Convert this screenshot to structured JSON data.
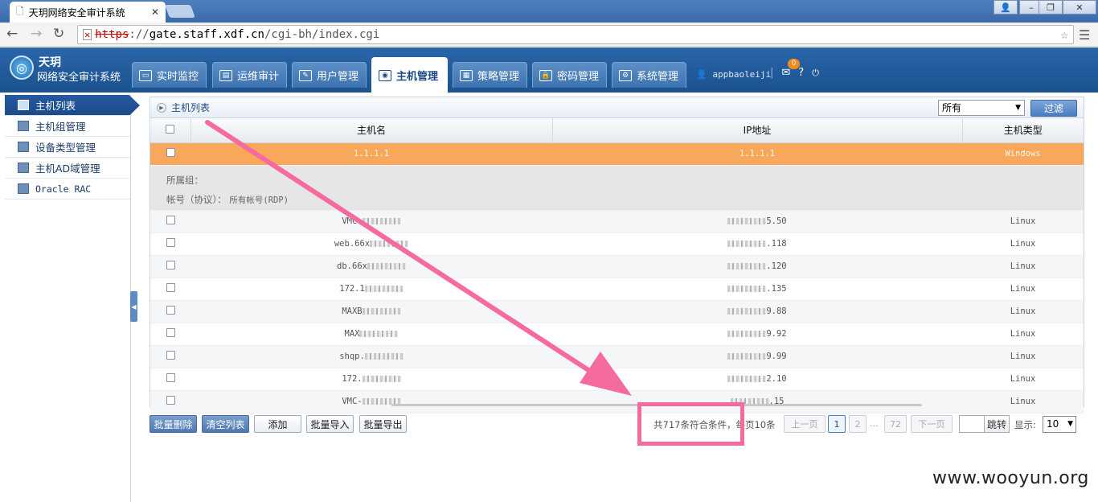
{
  "browser": {
    "tab_title": "天玥网络安全审计系统",
    "url_scheme": "https",
    "url_host": "gate.staff.xdf.cn",
    "url_path": "/cgi-bh/index.cgi",
    "url_rest": "://"
  },
  "app": {
    "brand_line1": "天玥",
    "brand_line2": "网络安全审计系统",
    "tabs": [
      {
        "label": "实时监控",
        "icon": "monitor-icon"
      },
      {
        "label": "运维审计",
        "icon": "audit-icon"
      },
      {
        "label": "用户管理",
        "icon": "user-icon"
      },
      {
        "label": "主机管理",
        "icon": "host-icon"
      },
      {
        "label": "策略管理",
        "icon": "policy-icon"
      },
      {
        "label": "密码管理",
        "icon": "lock-icon"
      },
      {
        "label": "系统管理",
        "icon": "gear-icon"
      }
    ],
    "active_tab": "主机管理",
    "username": "appbaoleiji",
    "mail_badge": "0",
    "help": "?",
    "logout": "⏻"
  },
  "sidebar": {
    "items": [
      {
        "label": "主机列表"
      },
      {
        "label": "主机组管理"
      },
      {
        "label": "设备类型管理"
      },
      {
        "label": "主机AD域管理"
      },
      {
        "label": "Oracle RAC"
      }
    ]
  },
  "panel": {
    "breadcrumb": "主机列表",
    "filter_select": "所有",
    "filter_button": "过滤",
    "columns": [
      "主机名",
      "IP地址",
      "主机类型"
    ],
    "selected_row": {
      "host": "1.1.1.1",
      "ip": "1.1.1.1",
      "type": "Windows"
    },
    "detail": {
      "group_label": "所属组：",
      "account_label": "帐号（协议）：",
      "account_value": "所有帐号(RDP)"
    },
    "rows": [
      {
        "host": "VMC-",
        "ip": "5.50",
        "type": "Linux"
      },
      {
        "host": "web.66x",
        "ip": ".118",
        "type": "Linux"
      },
      {
        "host": "db.66x",
        "ip": ".120",
        "type": "Linux"
      },
      {
        "host": "172.1",
        "ip": ".135",
        "type": "Linux"
      },
      {
        "host": "MAXB",
        "ip": "9.88",
        "type": "Linux"
      },
      {
        "host": "MAX",
        "ip": "9.92",
        "type": "Linux"
      },
      {
        "host": "shqp.",
        "ip": "9.99",
        "type": "Linux"
      },
      {
        "host": "172.",
        "ip": "2.10",
        "type": "Linux"
      },
      {
        "host": "VMC-",
        "ip": ".15",
        "type": "Linux"
      }
    ]
  },
  "footer": {
    "buttons": [
      "批量删除",
      "清空列表",
      "添加",
      "批量导入",
      "批量导出"
    ],
    "count_text": "共717条符合条件，每页10条",
    "prev": "上一页",
    "pages": [
      "1",
      "2",
      "72"
    ],
    "dots": "...",
    "next": "下一页",
    "jump": "跳转",
    "show_label": "显示:",
    "page_size": "10"
  },
  "watermark": "www.wooyun.org",
  "colors": {
    "annotation": "#f56a9f",
    "selected_row": "#f9a75a",
    "header": "#1b528f"
  }
}
